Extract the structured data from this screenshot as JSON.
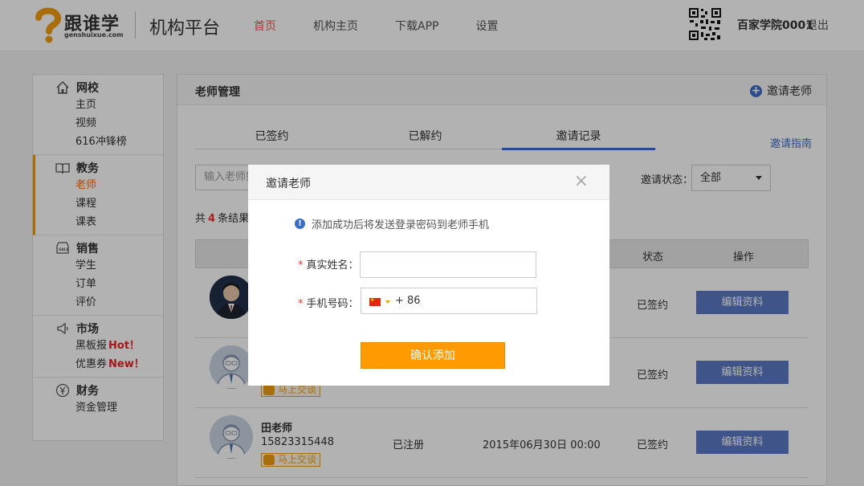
{
  "header": {
    "logo_cn": "跟谁学",
    "logo_en": "genshuixue.com",
    "platform": "机构平台",
    "nav": [
      "首页",
      "机构主页",
      "下载APP",
      "设置"
    ],
    "user": "百家学院0001",
    "logout": "退出"
  },
  "sidebar": {
    "groups": [
      {
        "title": "网校",
        "icon": "home-icon",
        "items": [
          "主页",
          "视频",
          "616冲锋榜"
        ]
      },
      {
        "title": "教务",
        "icon": "book-icon",
        "items": [
          "老师",
          "课程",
          "课表"
        ]
      },
      {
        "title": "销售",
        "icon": "sale-icon",
        "items": [
          "学生",
          "订单",
          "评价"
        ]
      },
      {
        "title": "市场",
        "icon": "megaphone-icon",
        "items": [
          "黑板报",
          "优惠券"
        ]
      },
      {
        "title": "财务",
        "icon": "yen-icon",
        "items": [
          "资金管理"
        ]
      }
    ],
    "badges": {
      "hot": "Hot！",
      "new": "New！"
    }
  },
  "main": {
    "title": "老师管理",
    "invite_label": "邀请老师",
    "tabs": [
      "已签约",
      "已解约",
      "邀请记录"
    ],
    "active_tab": 2,
    "guide": "邀请指南",
    "search_placeholder": "输入老师姓",
    "status_label": "邀请状态：",
    "status_value": "全部",
    "total_prefix": "共",
    "total_count": "4",
    "total_suffix": "条结果",
    "headers": [
      "状态",
      "操作"
    ],
    "rows": [
      {
        "name": "",
        "phone": "",
        "reg": "",
        "date": "",
        "status": "已签约",
        "action": "编辑资料",
        "chat": ""
      },
      {
        "name": "",
        "phone": "",
        "reg": "",
        "date": "",
        "status": "已签约",
        "action": "编辑资料",
        "chat": "马上交谈"
      },
      {
        "name": "田老师",
        "phone": "15823315448",
        "reg": "已注册",
        "date": "2015年06月30日 00:00",
        "status": "已签约",
        "action": "编辑资料",
        "chat": "马上交谈"
      }
    ]
  },
  "modal": {
    "title": "邀请老师",
    "close": "×",
    "tip": "添加成功后将发送登录密码到老师手机",
    "name_label": "真实姓名：",
    "name_value": "",
    "phone_label": "手机号码：",
    "country_code": "+ 86",
    "phone_value": "",
    "confirm": "确认添加"
  },
  "colors": {
    "accent": "#3a6cc9",
    "orange": "#ff9b00",
    "active_nav": "#e55",
    "edit_button": "#5b7ac4"
  }
}
